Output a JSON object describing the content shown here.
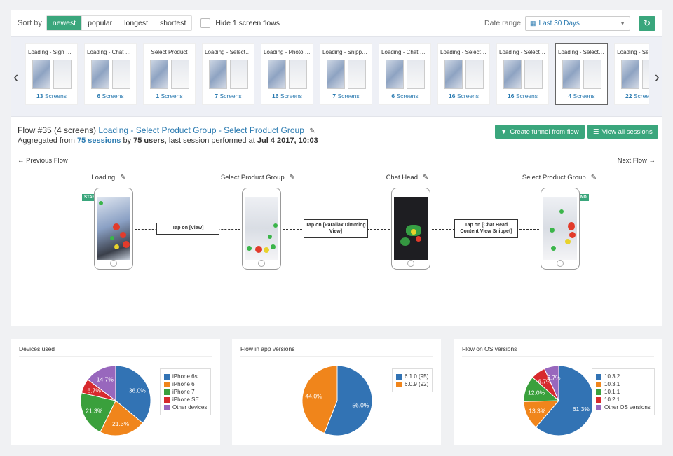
{
  "toolbar": {
    "sort_label": "Sort by",
    "sort_options": [
      "newest",
      "popular",
      "longest",
      "shortest"
    ],
    "active_sort": "newest",
    "hide_label": "Hide 1 screen flows",
    "date_range_label": "Date range",
    "date_range_value": "Last 30 Days",
    "colors": {
      "accent": "#3aa67c",
      "link": "#2a7ab0"
    }
  },
  "carousel": {
    "thumbs": [
      {
        "title": "Loading - Sign Up - S...",
        "count": "13",
        "unit": "Screens"
      },
      {
        "title": "Loading - Chat Head ...",
        "count": "6",
        "unit": "Screens"
      },
      {
        "title": "Select Product",
        "count": "1",
        "unit": "Screens"
      },
      {
        "title": "Loading - Select Prod...",
        "count": "7",
        "unit": "Screens"
      },
      {
        "title": "Loading - Photo Previ...",
        "count": "16",
        "unit": "Screens"
      },
      {
        "title": "Loading - Snippets - ...",
        "count": "7",
        "unit": "Screens"
      },
      {
        "title": "Loading - Chat Head ...",
        "count": "6",
        "unit": "Screens"
      },
      {
        "title": "Loading - Select Prod...",
        "count": "16",
        "unit": "Screens"
      },
      {
        "title": "Loading - Select Prod...",
        "count": "16",
        "unit": "Screens"
      },
      {
        "title": "Loading - Select Prod...",
        "count": "4",
        "unit": "Screens"
      },
      {
        "title": "Loading - Select ...",
        "count": "22",
        "unit": "Screens"
      }
    ],
    "selected_index": 9
  },
  "flow": {
    "title_prefix": "Flow #35 (4 screens)",
    "title_link": "Loading - Select Product Group - Select Product Group",
    "sub_prefix": "Aggregated from",
    "sessions": "75 sessions",
    "sub_by": "by",
    "users": "75 users",
    "sub_rest": ", last session performed at",
    "last_session": "Jul 4 2017, 10:03",
    "btn_funnel": "Create funnel from flow",
    "btn_sessions": "View all sessions",
    "prev": "← Previous Flow",
    "next": "Next Flow →",
    "start_tag": "START",
    "end_tag": "END",
    "steps": [
      {
        "label": "Loading"
      },
      {
        "label": "Select Product Group"
      },
      {
        "label": "Chat Head"
      },
      {
        "label": "Select Product Group"
      }
    ],
    "actions": [
      "Tap on [View]",
      "Tap on [Parallax Dimming View]",
      "Tap on [Chat Head Content View Snippet]"
    ]
  },
  "charts": {
    "chart_data": [
      {
        "type": "pie",
        "title": "Devices used",
        "categories": [
          "iPhone 6s",
          "iPhone 6",
          "iPhone 7",
          "iPhone SE",
          "Other devices"
        ],
        "values": [
          36.0,
          21.3,
          21.3,
          6.7,
          14.7
        ],
        "labels": [
          "36.0%",
          "21.3%",
          "21.3%",
          "6.7%",
          "14.7%"
        ],
        "colors": [
          "#3273b4",
          "#f0851b",
          "#3aa03c",
          "#d72a2d",
          "#9867bd"
        ],
        "legend": "right"
      },
      {
        "type": "pie",
        "title": "Flow in app versions",
        "categories": [
          "6.1.0 (95)",
          "6.0.9 (92)"
        ],
        "values": [
          56.0,
          44.0
        ],
        "labels": [
          "56.0%",
          "44.0%"
        ],
        "colors": [
          "#3273b4",
          "#f0851b"
        ],
        "legend": "right"
      },
      {
        "type": "pie",
        "title": "Flow on OS versions",
        "categories": [
          "10.3.2",
          "10.3.1",
          "10.1.1",
          "10.2.1",
          "Other OS versions"
        ],
        "values": [
          61.3,
          13.3,
          12.0,
          6.7,
          6.7
        ],
        "labels": [
          "61.3%",
          "13.3%",
          "12.0%",
          "6.7%",
          "6.7%"
        ],
        "colors": [
          "#3273b4",
          "#f0851b",
          "#3aa03c",
          "#d72a2d",
          "#9867bd"
        ],
        "legend": "right"
      }
    ]
  }
}
